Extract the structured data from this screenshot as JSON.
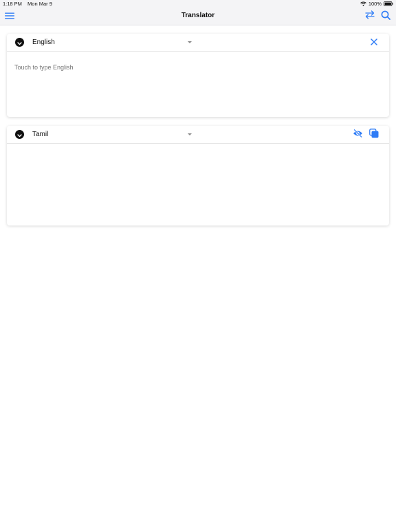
{
  "status_bar": {
    "time": "1:18 PM",
    "date": "Mon Mar 9",
    "battery": "100%"
  },
  "nav": {
    "title": "Translator",
    "icons": {
      "menu": "hamburger-menu-icon",
      "swap": "swap-arrows-icon",
      "search": "search-icon"
    }
  },
  "source": {
    "language": "English",
    "placeholder": "Touch to type English",
    "value": ""
  },
  "target": {
    "language": "Tamil",
    "value": ""
  },
  "colors": {
    "accent": "#2f7cf6",
    "bar_background": "#f4f4f6",
    "text": "#111111",
    "placeholder": "#b8b8bd"
  }
}
